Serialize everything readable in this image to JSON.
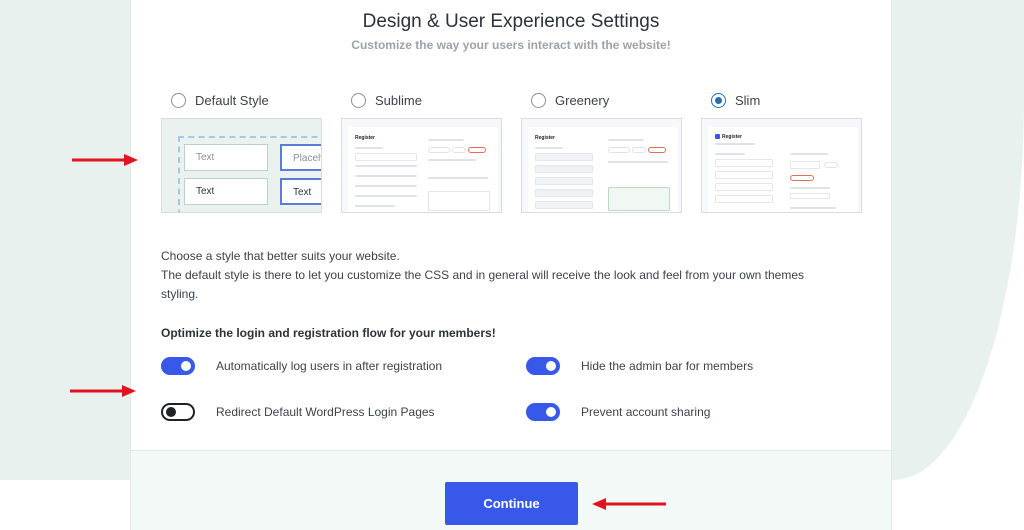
{
  "header": {
    "title": "Design & User Experience Settings",
    "subtitle": "Customize the way your users interact with the website!"
  },
  "styles": [
    {
      "label": "Default Style",
      "selected": false
    },
    {
      "label": "Sublime",
      "selected": false
    },
    {
      "label": "Greenery",
      "selected": false
    },
    {
      "label": "Slim",
      "selected": true
    }
  ],
  "default_preview": {
    "field_1": "Text",
    "field_2": "Placeholder",
    "field_3": "Text",
    "field_4": "Text"
  },
  "preview_heading": "Register",
  "description": {
    "line_1": "Choose a style that better suits your website.",
    "line_2": "The default style is there to let you customize the CSS and in general will receive the look and feel from your own themes styling."
  },
  "flow": {
    "heading": "Optimize the login and registration flow for your members!",
    "toggles": [
      {
        "label": "Automatically log users in after registration",
        "on": true
      },
      {
        "label": "Hide the admin bar for members",
        "on": true
      },
      {
        "label": "Redirect Default WordPress Login Pages",
        "on": false
      },
      {
        "label": "Prevent account sharing",
        "on": true
      }
    ]
  },
  "footer": {
    "continue_label": "Continue"
  },
  "colors": {
    "accent": "#3858e9",
    "annotation_arrow": "#e0141e",
    "background_tint": "#e9f1ee"
  }
}
